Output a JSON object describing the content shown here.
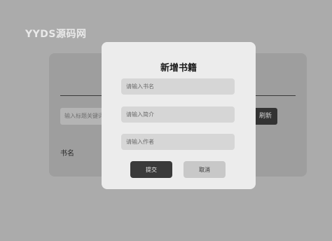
{
  "brand": {
    "logo_text": "YYDS源码网"
  },
  "background": {
    "search_placeholder": "输入标题关键词",
    "search_button_label": "刷新",
    "column_header": "书名"
  },
  "modal": {
    "title": "新增书籍",
    "fields": [
      {
        "placeholder": "请输入书名",
        "value": ""
      },
      {
        "placeholder": "请输入简介",
        "value": ""
      },
      {
        "placeholder": "请输入作者",
        "value": ""
      }
    ],
    "submit_label": "提交",
    "cancel_label": "取消"
  }
}
